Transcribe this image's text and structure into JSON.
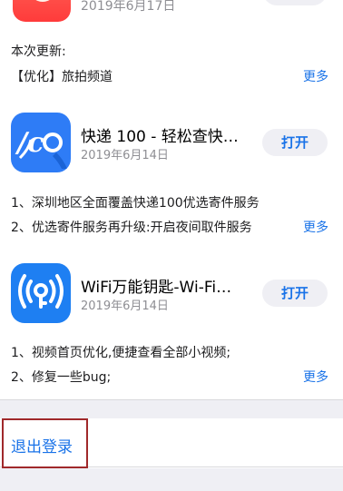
{
  "top_app": {
    "date": "2019年6月17日",
    "notes_title": "本次更新:",
    "notes_line": "【优化】旅拍频道",
    "more_label": "更多"
  },
  "apps": [
    {
      "name": "快递 100 - 轻松查快…",
      "date": "2019年6月14日",
      "button_label": "打开",
      "notes": [
        "1、深圳地区全面覆盖快递100优选寄件服务",
        "2、优选寄件服务再升级:开启夜间取件服务"
      ],
      "more_label": "更多"
    },
    {
      "name": "WiFi万能钥匙-Wi-Fi…",
      "date": "2019年6月14日",
      "button_label": "打开",
      "notes": [
        "1、视频首页优化,便捷查看全部小视频;",
        "2、修复一些bug;"
      ],
      "more_label": "更多"
    }
  ],
  "account": {
    "logout_label": "退出登录"
  },
  "colors": {
    "accent": "#1a73e8",
    "highlight_border": "#a0292b",
    "button_bg": "#efeff4"
  },
  "icons": {
    "app0": "red-app-icon",
    "app1": "kuaidi100-icon",
    "app2": "wifi-key-icon"
  }
}
